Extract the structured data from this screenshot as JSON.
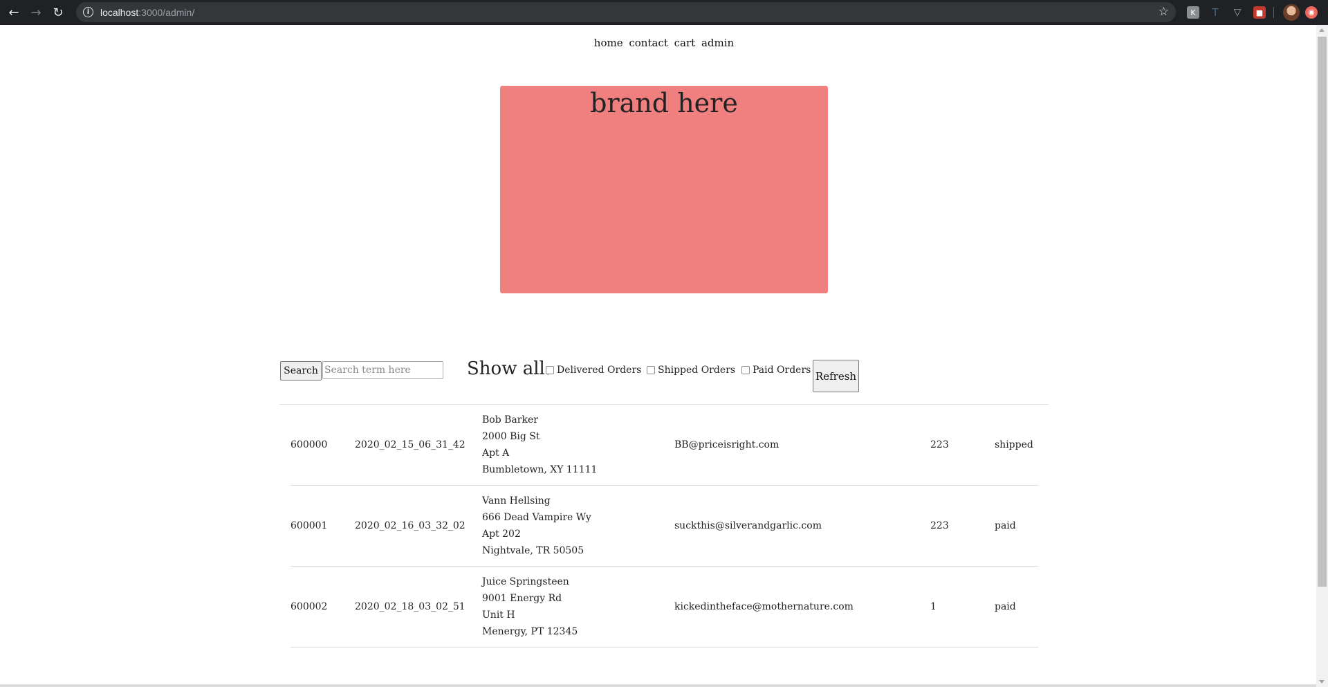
{
  "browser": {
    "url_host": "localhost",
    "url_path": ":3000/admin/"
  },
  "nav": {
    "home": "home",
    "contact": "contact",
    "cart": "cart",
    "admin": "admin"
  },
  "brand": {
    "text": "brand here",
    "color": "#f08080"
  },
  "search": {
    "button_label": "Search",
    "placeholder": "Search term here",
    "value": ""
  },
  "filters": {
    "show_all_label": "Show all:",
    "options": [
      {
        "label": "Delivered Orders",
        "checked": false
      },
      {
        "label": "Shipped Orders",
        "checked": false
      },
      {
        "label": "Paid Orders",
        "checked": false
      }
    ],
    "refresh_label": "Refresh"
  },
  "orders": [
    {
      "id": "600000",
      "date": "2020_02_15_06_31_42",
      "address": [
        "Bob Barker",
        "2000 Big St",
        "Apt A",
        "Bumbletown, XY 11111"
      ],
      "email": "BB@priceisright.com",
      "qty": "223",
      "status": "shipped"
    },
    {
      "id": "600001",
      "date": "2020_02_16_03_32_02",
      "address": [
        "Vann Hellsing",
        "666 Dead Vampire Wy",
        "Apt 202",
        "Nightvale, TR 50505"
      ],
      "email": "suckthis@silverandgarlic.com",
      "qty": "223",
      "status": "paid"
    },
    {
      "id": "600002",
      "date": "2020_02_18_03_02_51",
      "address": [
        "Juice Springsteen",
        "9001 Energy Rd",
        "Unit H",
        "Menergy, PT 12345"
      ],
      "email": "kickedintheface@mothernature.com",
      "qty": "1",
      "status": "paid"
    }
  ]
}
